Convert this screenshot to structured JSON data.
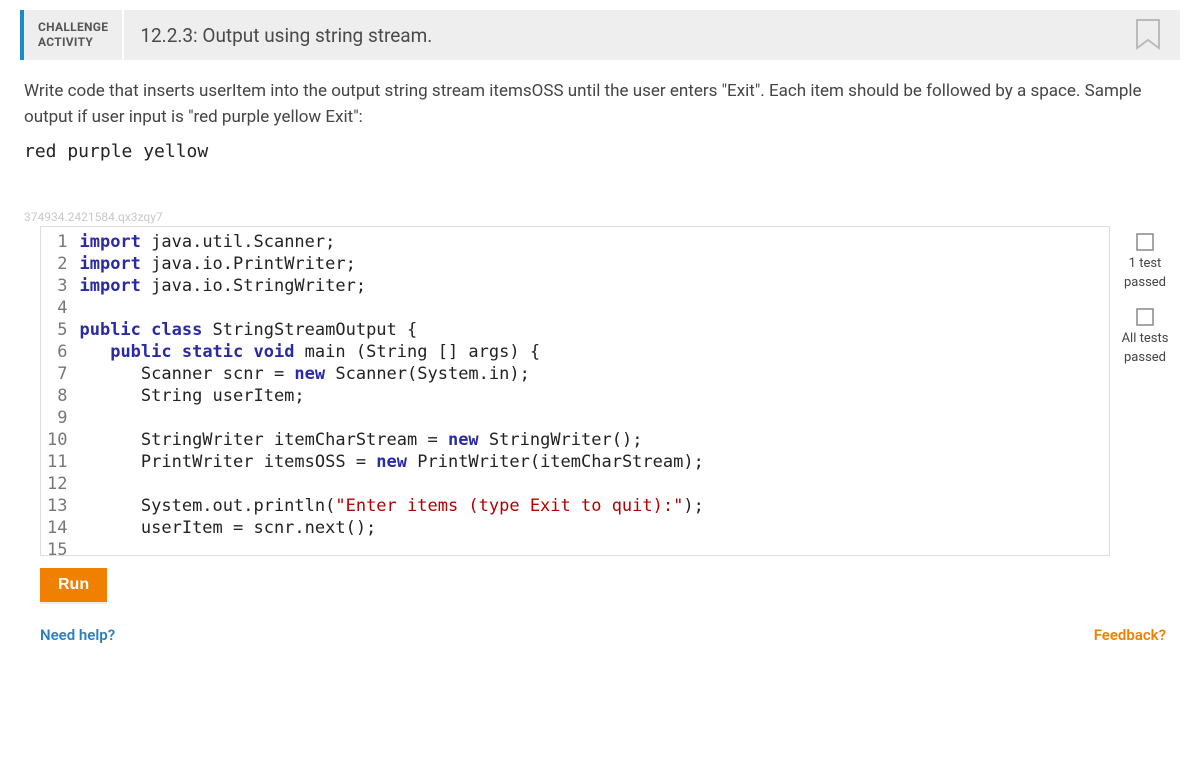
{
  "header": {
    "badge_line1": "CHALLENGE",
    "badge_line2": "ACTIVITY",
    "title": "12.2.3: Output using string stream."
  },
  "instructions": {
    "text": "Write code that inserts userItem into the output string stream itemsOSS until the user enters \"Exit\". Each item should be followed by a space. Sample output if user input is \"red purple yellow Exit\":",
    "sample_output": "red purple yellow"
  },
  "watermark": "374934.2421584.qx3zqy7",
  "code": {
    "line_numbers": [
      "1",
      "2",
      "3",
      "4",
      "5",
      "6",
      "7",
      "8",
      "9",
      "10",
      "11",
      "12",
      "13",
      "14",
      "15"
    ],
    "tokens": [
      [
        {
          "t": "import ",
          "c": "kw"
        },
        {
          "t": "java.util.Scanner;",
          "c": "plain"
        }
      ],
      [
        {
          "t": "import ",
          "c": "kw"
        },
        {
          "t": "java.io.PrintWriter;",
          "c": "plain"
        }
      ],
      [
        {
          "t": "import ",
          "c": "kw"
        },
        {
          "t": "java.io.StringWriter;",
          "c": "plain"
        }
      ],
      [
        {
          "t": "",
          "c": "plain"
        }
      ],
      [
        {
          "t": "public class ",
          "c": "kw"
        },
        {
          "t": "StringStreamOutput {",
          "c": "plain"
        }
      ],
      [
        {
          "t": "   ",
          "c": "plain"
        },
        {
          "t": "public static void ",
          "c": "kw"
        },
        {
          "t": "main (String [] args) {",
          "c": "plain"
        }
      ],
      [
        {
          "t": "      Scanner scnr = ",
          "c": "plain"
        },
        {
          "t": "new ",
          "c": "kw"
        },
        {
          "t": "Scanner(System.in);",
          "c": "plain"
        }
      ],
      [
        {
          "t": "      String userItem;",
          "c": "plain"
        }
      ],
      [
        {
          "t": "",
          "c": "plain"
        }
      ],
      [
        {
          "t": "      StringWriter itemCharStream = ",
          "c": "plain"
        },
        {
          "t": "new ",
          "c": "kw"
        },
        {
          "t": "StringWriter();",
          "c": "plain"
        }
      ],
      [
        {
          "t": "      PrintWriter itemsOSS = ",
          "c": "plain"
        },
        {
          "t": "new ",
          "c": "kw"
        },
        {
          "t": "PrintWriter(itemCharStream);",
          "c": "plain"
        }
      ],
      [
        {
          "t": "",
          "c": "plain"
        }
      ],
      [
        {
          "t": "      System.out.println(",
          "c": "plain"
        },
        {
          "t": "\"Enter items (type Exit to quit):\"",
          "c": "str"
        },
        {
          "t": ");",
          "c": "plain"
        }
      ],
      [
        {
          "t": "      userItem = scnr.next();",
          "c": "plain"
        }
      ],
      [
        {
          "t": "",
          "c": "plain"
        }
      ]
    ]
  },
  "run_button": "Run",
  "status": {
    "item1": {
      "line1": "1 test",
      "line2": "passed"
    },
    "item2": {
      "line1": "All tests",
      "line2": "passed"
    }
  },
  "links": {
    "help": "Need help?",
    "feedback": "Feedback?"
  }
}
